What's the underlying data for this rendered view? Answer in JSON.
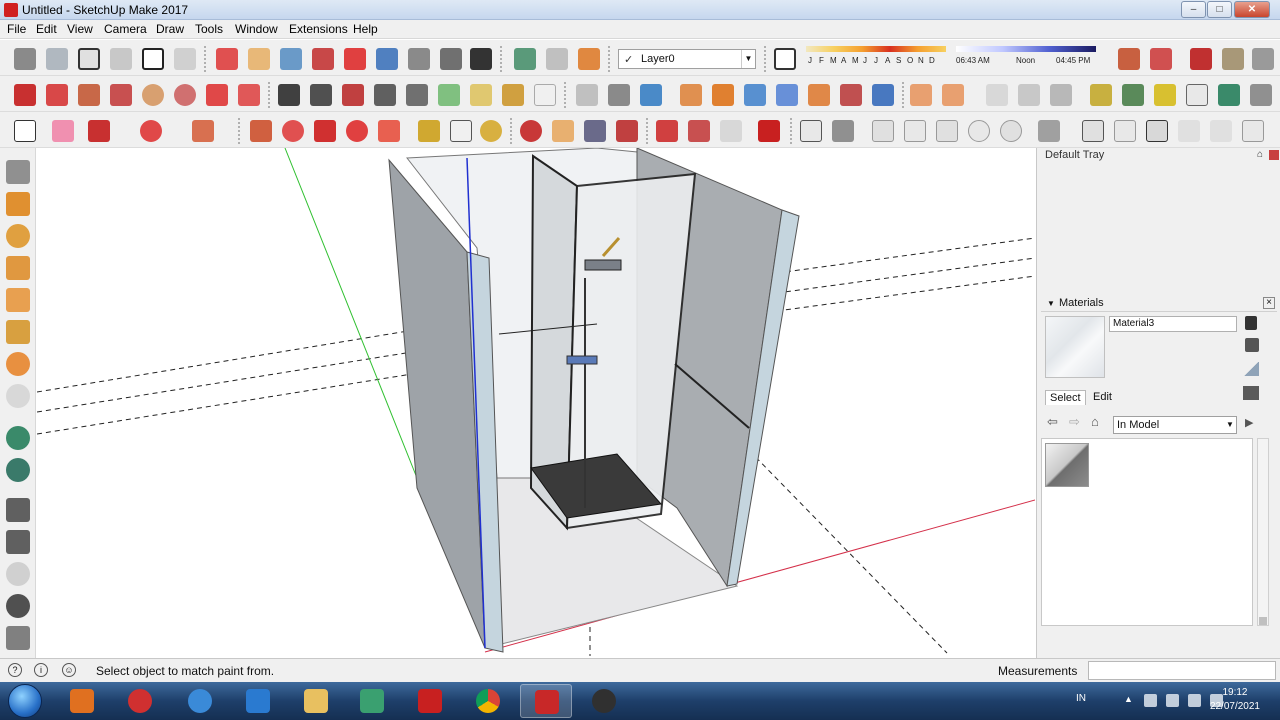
{
  "window": {
    "title": "Untitled - SketchUp Make 2017",
    "controls": {
      "minimize": "–",
      "maximize": "□",
      "close": "✕"
    }
  },
  "menu": [
    "File",
    "Edit",
    "View",
    "Camera",
    "Draw",
    "Tools",
    "Window",
    "Extensions",
    "Help"
  ],
  "layers": {
    "check": "✓",
    "current": "Layer0"
  },
  "shadows": {
    "months": [
      "J",
      "F",
      "M",
      "A",
      "M",
      "J",
      "J",
      "A",
      "S",
      "O",
      "N",
      "D"
    ],
    "times": [
      "06:43 AM",
      "Noon",
      "04:45 PM"
    ]
  },
  "tray": {
    "title": "Default Tray",
    "pin_icon": "✉",
    "materials": {
      "title": "Materials",
      "collapse_icon": "▼",
      "close_icon": "×",
      "name": "Material3",
      "tabs": [
        "Select",
        "Edit"
      ],
      "library": "In Model",
      "back_icon": "⇦",
      "forward_icon": "⇨",
      "home_icon": "⌂",
      "details_icon": "▶"
    }
  },
  "status": {
    "message": "Select object to match paint from.",
    "measurements_label": "Measurements",
    "measurements_value": ""
  },
  "taskbar": {
    "language": "IN",
    "time": "19:12",
    "date": "22/07/2021"
  },
  "colors": {
    "axis_red": "#d4304a",
    "axis_green": "#30c030",
    "axis_blue": "#2030d0",
    "wall": "#a9adb1",
    "floor_dark": "#3a3a3a"
  }
}
